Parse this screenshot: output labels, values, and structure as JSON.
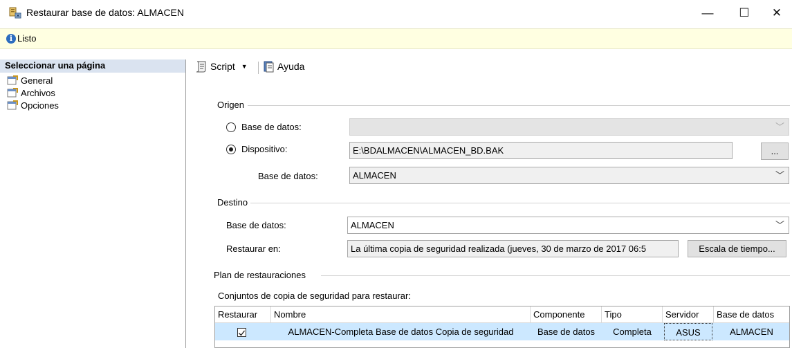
{
  "window": {
    "title": "Restaurar base de datos: ALMACEN",
    "minimize": "—",
    "maximize": "☐",
    "close": "✕"
  },
  "status": {
    "text": "Listo",
    "icon": "info-icon"
  },
  "left_panel": {
    "title": "Seleccionar una página",
    "items": [
      "General",
      "Archivos",
      "Opciones"
    ]
  },
  "toolbar": {
    "script_label": "Script",
    "help_label": "Ayuda"
  },
  "origen": {
    "title": "Origen",
    "database_radio_label": "Base de datos:",
    "database_value": "",
    "device_radio_label": "Dispositivo:",
    "device_value": "E:\\BDALMACEN\\ALMACEN_BD.BAK",
    "browse_label": "...",
    "device_database_label": "Base de datos:",
    "device_database_value": "ALMACEN",
    "selected_option": "Dispositivo"
  },
  "destino": {
    "title": "Destino",
    "database_label": "Base de datos:",
    "database_value": "ALMACEN",
    "restore_to_label": "Restaurar en:",
    "restore_to_value": "La última copia de seguridad realizada (jueves, 30 de marzo de 2017 06:5",
    "timeline_button": "Escala de tiempo..."
  },
  "plan": {
    "title": "Plan de restauraciones",
    "sets_label": "Conjuntos de copia de seguridad para restaurar:",
    "columns": [
      "Restaurar",
      "Nombre",
      "Componente",
      "Tipo",
      "Servidor",
      "Base de datos"
    ],
    "rows": [
      {
        "restaurar": true,
        "nombre": "ALMACEN-Completa Base de datos Copia de seguridad",
        "componente": "Base de datos",
        "tipo": "Completa",
        "servidor": "ASUS",
        "base_de_datos": "ALMACEN"
      }
    ]
  },
  "colors": {
    "status_bg": "#ffffe1",
    "panel_header_bg": "#dae3f0",
    "selected_row_bg": "#cce8ff",
    "info_icon": "#2d6dbf"
  }
}
